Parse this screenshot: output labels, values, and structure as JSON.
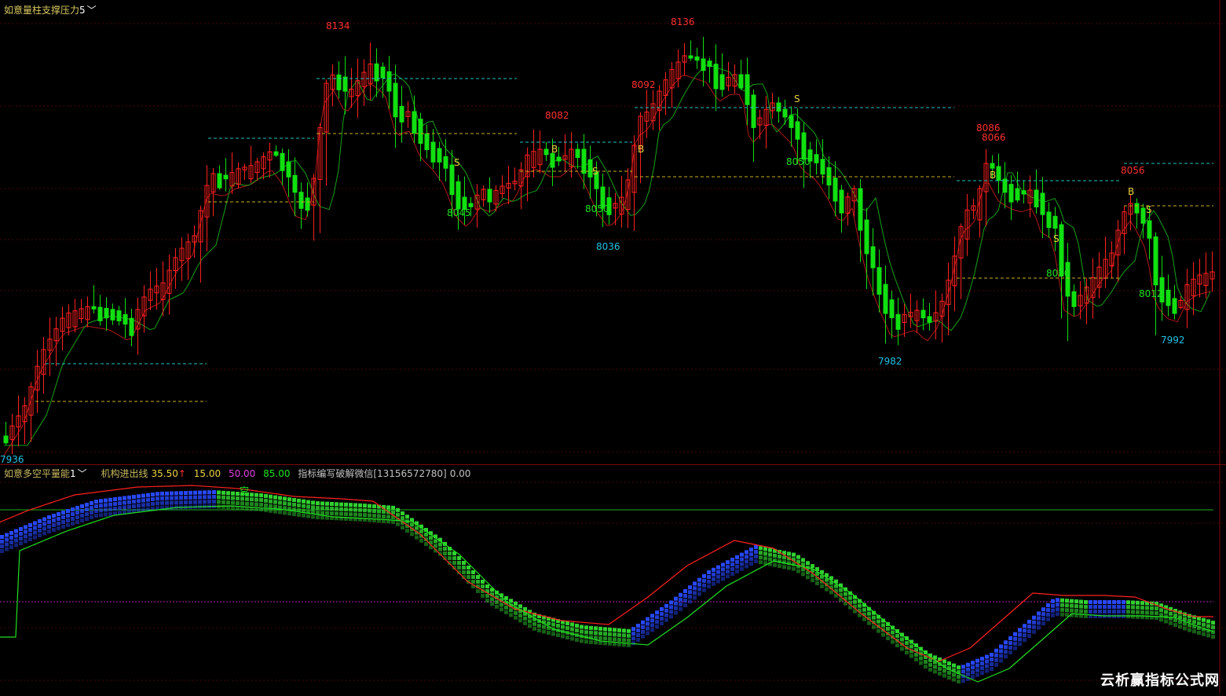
{
  "main_header": {
    "indicator_name": "如意量柱支撑压力",
    "param": "5",
    "dropdown_icon": "chevron-down-icon",
    "title_color": "#d8c860",
    "param_color": "#ffffff"
  },
  "sub_header": {
    "indicator_name": "如意多空平量能",
    "param": "1",
    "dropdown_icon": "chevron-down-icon",
    "items": [
      {
        "label": "机构进出线",
        "value": "35.50",
        "arrow": "↑",
        "color": "#e8d040"
      },
      {
        "label": "",
        "value": "15.00",
        "color": "#e8d040"
      },
      {
        "label": "",
        "value": "50.00",
        "color": "#e040e0"
      },
      {
        "label": "",
        "value": "85.00",
        "color": "#20e020"
      },
      {
        "label": "指标编写破解微信[13156572780]",
        "value": "0.00",
        "color": "#c0c0c0"
      }
    ]
  },
  "price_labels": {
    "high_labels": [
      "8134",
      "8136",
      "8092",
      "8082",
      "8086",
      "8066",
      "8056"
    ],
    "low_labels": [
      "8036",
      "7982",
      "7992"
    ],
    "green_labels": [
      "8045",
      "8050",
      "8050",
      "8020",
      "8012"
    ],
    "start_label": "7936"
  },
  "signal_labels": {
    "buy": "B",
    "sell": "S",
    "empty": "空"
  },
  "watermark": "云析赢指标公式网",
  "colors": {
    "up": "#ff2020",
    "down": "#00e000",
    "cyan": "#20c0c0",
    "yellow": "#e8d040",
    "grid_red": "#7a0a0a",
    "blue": "#2040ff"
  }
}
